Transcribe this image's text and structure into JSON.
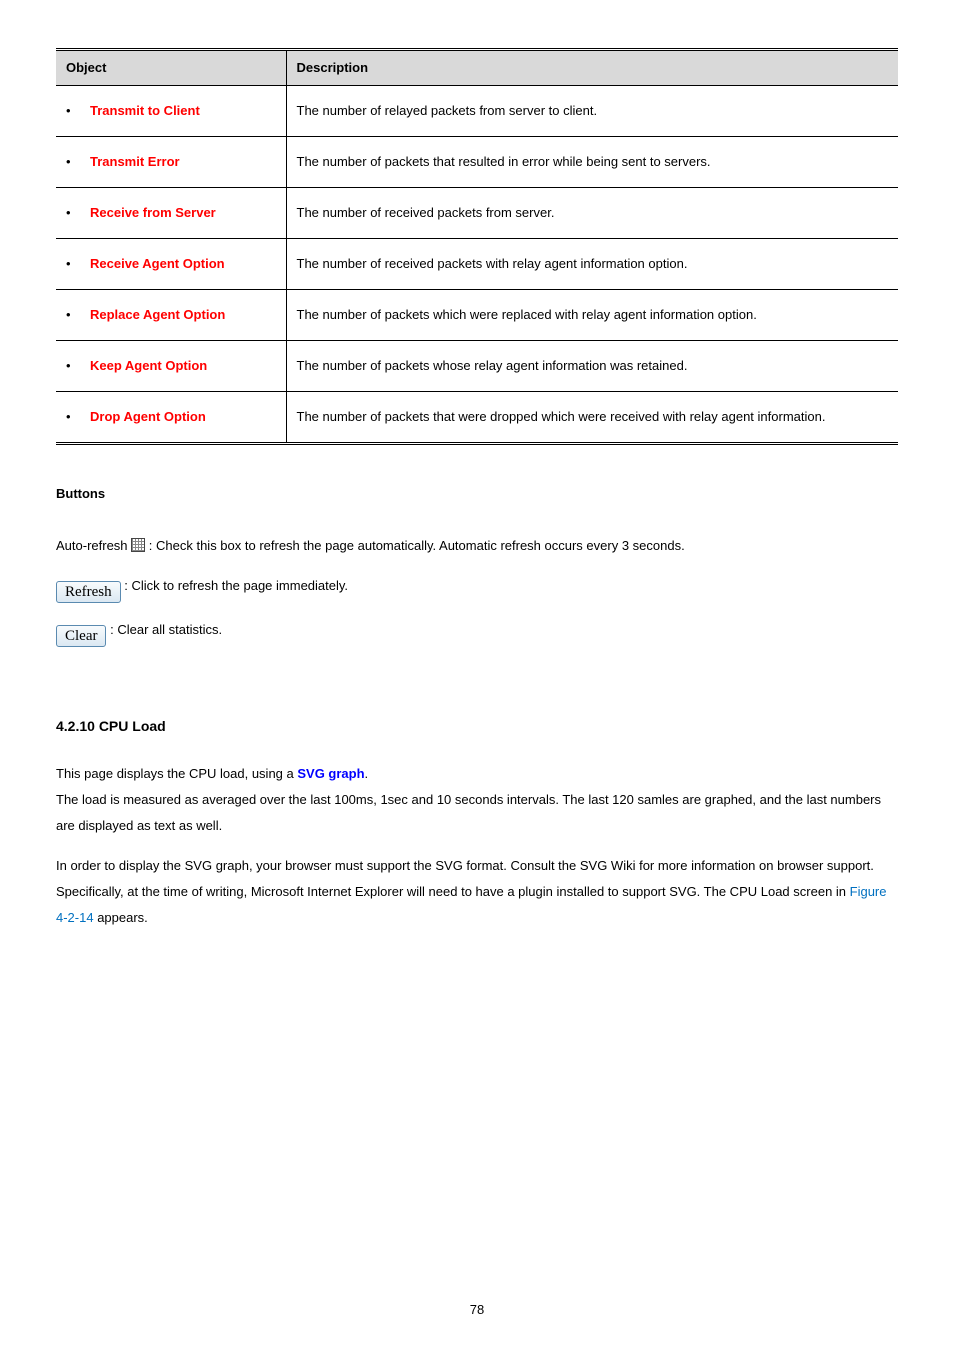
{
  "table": {
    "header": {
      "object": "Object",
      "description": "Description"
    },
    "rows": [
      {
        "object": "Transmit to Client",
        "desc": "The number of relayed packets from server to client."
      },
      {
        "object": "Transmit Error",
        "desc": "The number of packets that resulted in error while being sent to servers."
      },
      {
        "object": "Receive from Server",
        "desc": "The number of received packets from server."
      },
      {
        "object": "Receive Agent Option",
        "desc": "The number of received packets with relay agent information option."
      },
      {
        "object": "Replace Agent Option",
        "desc": "The number of packets which were replaced with relay agent information option."
      },
      {
        "object": "Keep Agent Option",
        "desc": "The number of packets whose relay agent information was retained."
      },
      {
        "object": "Drop Agent Option",
        "desc": "The number of packets that were dropped which were received with relay agent information."
      }
    ]
  },
  "buttons_heading": "Buttons",
  "autorefresh": {
    "pre": "Auto-refresh ",
    "post": " : Check this box to refresh the page automatically. Automatic refresh occurs every 3 seconds."
  },
  "refresh": {
    "btn": "Refresh",
    "text": ": Click to refresh the page immediately."
  },
  "clear": {
    "btn": "Clear",
    "text": ": Clear all statistics."
  },
  "cpu_load": {
    "heading": "4.2.10 CPU Load",
    "p1a": "This page displays the CPU load, using a ",
    "p1b": "SVG graph",
    "p1c": ".",
    "p2": "The load is measured as averaged over the last 100ms, 1sec and 10 seconds intervals. The last 120 samles are graphed, and the last numbers are displayed as text as well.",
    "p3a": "In order to display the SVG graph, your browser must support the SVG format. Consult the SVG Wiki for more information on browser support. Specifically, at the time of writing, Microsoft Internet Explorer will need to have a plugin installed to support SVG. The CPU Load screen in ",
    "p3b": "Figure 4-2-14",
    "p3c": " appears."
  },
  "page_number": "78"
}
